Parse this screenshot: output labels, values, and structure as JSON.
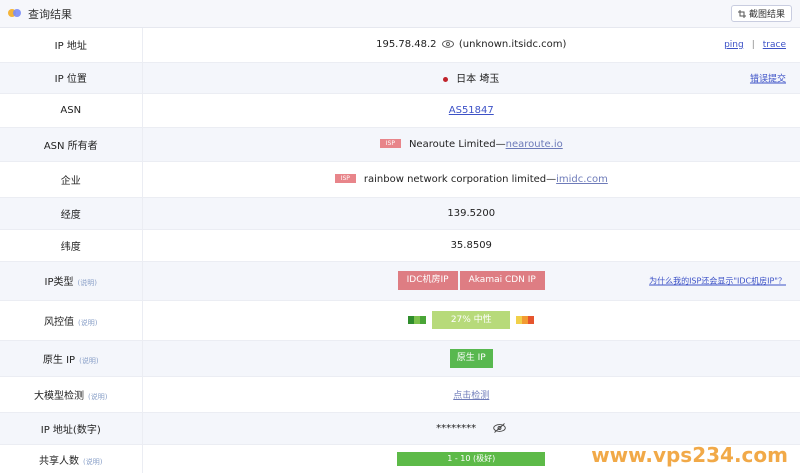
{
  "header": {
    "title": "查询结果",
    "screenshot_label": "截图结果"
  },
  "rows": {
    "ip_address": {
      "key": "IP 地址",
      "value": "195.78.48.2",
      "hostname": "(unknown.itsidc.com)",
      "ping": "ping",
      "separator": "|",
      "trace": "trace"
    },
    "ip_location": {
      "key": "IP 位置",
      "value": "日本 埼玉",
      "side": "错误提交"
    },
    "asn": {
      "key": "ASN",
      "value": "AS51847"
    },
    "asn_owner": {
      "key": "ASN 所有者",
      "badge": "ISP",
      "value": "Nearoute Limited—",
      "link": "nearoute.io"
    },
    "company": {
      "key": "企业",
      "badge": "ISP",
      "value": "rainbow network corporation limited—",
      "link": "imidc.com"
    },
    "longitude": {
      "key": "经度",
      "value": "139.5200"
    },
    "latitude": {
      "key": "纬度",
      "value": "35.8509"
    },
    "ip_type": {
      "key": "IP类型",
      "note": "(说明)",
      "tags": [
        "IDC机房IP",
        "Akamai CDN IP"
      ],
      "side": "为什么我的ISP还会显示\"IDC机房IP\"？"
    },
    "risk": {
      "key": "风控值",
      "note": "(说明)",
      "value": "27% 中性"
    },
    "native_ip": {
      "key": "原生 IP",
      "note": "(说明)",
      "value": "原生 IP"
    },
    "llm_detect": {
      "key": "大模型检测",
      "note": "(说明)",
      "value": "点击检测"
    },
    "ip_numeric": {
      "key": "IP 地址(数字)",
      "value": "********"
    },
    "shared_users": {
      "key": "共享人数",
      "note": "(说明)",
      "value": "1 - 10 (极好)"
    }
  },
  "colors": {
    "risk_left": [
      "#2f8d2c",
      "#7cc14c",
      "#4aa537"
    ],
    "risk_right": [
      "#f1d04a",
      "#f39b32",
      "#e6552e"
    ]
  },
  "watermark": "www.vps234.com"
}
